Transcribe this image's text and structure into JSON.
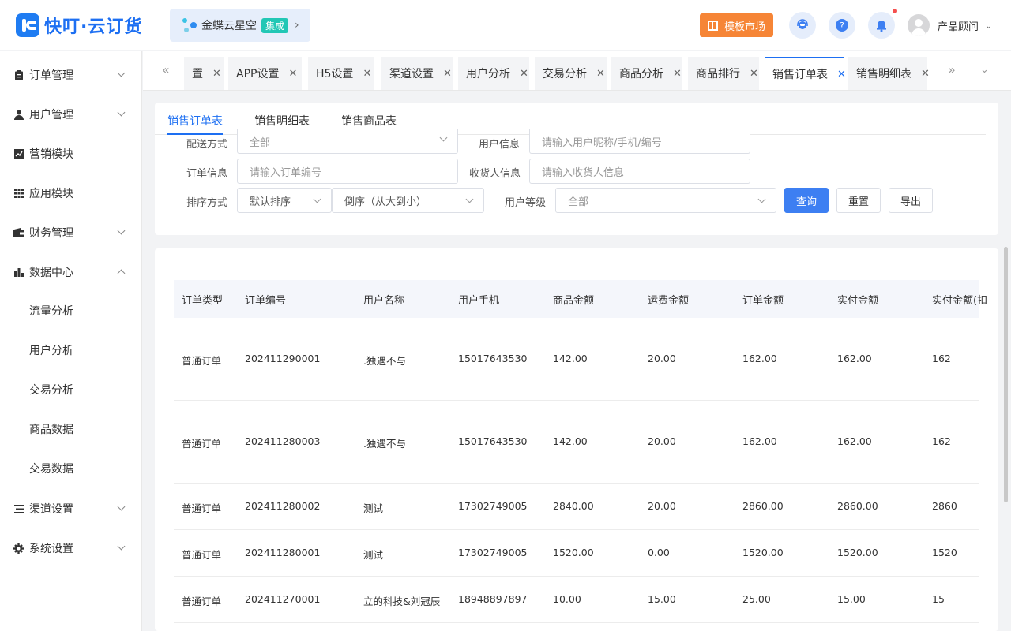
{
  "app": {
    "brand": "快叮·云订货"
  },
  "header": {
    "kingdee_label": "金蝶云星空",
    "kingdee_tag": "集成",
    "template_market": "模板市场",
    "user_name": "产品顾问"
  },
  "sidebar": {
    "items": [
      {
        "label": "订单管理",
        "icon": "clipboard-icon",
        "expandable": true
      },
      {
        "label": "用户管理",
        "icon": "user-icon",
        "expandable": true
      },
      {
        "label": "营销模块",
        "icon": "chart-line-icon",
        "expandable": false
      },
      {
        "label": "应用模块",
        "icon": "grid-icon",
        "expandable": false
      },
      {
        "label": "财务管理",
        "icon": "wallet-icon",
        "expandable": true
      },
      {
        "label": "数据中心",
        "icon": "bar-chart-icon",
        "expandable": true,
        "expanded": true
      },
      {
        "label": "渠道设置",
        "icon": "list-icon",
        "expandable": true
      },
      {
        "label": "系统设置",
        "icon": "gear-icon",
        "expandable": true
      }
    ],
    "data_center_children": [
      "流量分析",
      "用户分析",
      "交易分析",
      "商品数据",
      "交易数据"
    ]
  },
  "tabs": [
    {
      "label": "置"
    },
    {
      "label": "APP设置"
    },
    {
      "label": "H5设置"
    },
    {
      "label": "渠道设置"
    },
    {
      "label": "用户分析"
    },
    {
      "label": "交易分析"
    },
    {
      "label": "商品分析"
    },
    {
      "label": "商品排行"
    },
    {
      "label": "销售订单表",
      "active": true
    },
    {
      "label": "销售明细表"
    }
  ],
  "subtabs": [
    "销售订单表",
    "销售明细表",
    "销售商品表"
  ],
  "filters": {
    "delivery_label": "配送方式",
    "delivery_value": "全部",
    "userinfo_label": "用户信息",
    "userinfo_placeholder": "请输入用户昵称/手机/编号",
    "order_label": "订单信息",
    "order_placeholder": "请输入订单编号",
    "receiver_label": "收货人信息",
    "receiver_placeholder": "请输入收货人信息",
    "sort_label": "排序方式",
    "sort_value": "默认排序",
    "order_dir_value": "倒序（从大到小）",
    "level_label": "用户等级",
    "level_value": "全部",
    "query": "查询",
    "reset": "重置",
    "export": "导出"
  },
  "table": {
    "columns": [
      "订单类型",
      "订单编号",
      "用户名称",
      "用户手机",
      "商品金额",
      "运费金额",
      "订单金额",
      "实付金额",
      "实付金额(扣"
    ],
    "rows": [
      [
        "普通订单",
        "202411290001",
        ".独遇不与",
        "15017643530",
        "142.00",
        "20.00",
        "162.00",
        "162.00",
        "162"
      ],
      [
        "普通订单",
        "202411280003",
        ".独遇不与",
        "15017643530",
        "142.00",
        "20.00",
        "162.00",
        "162.00",
        "162"
      ],
      [
        "普通订单",
        "202411280002",
        "测试",
        "17302749005",
        "2840.00",
        "20.00",
        "2860.00",
        "2860.00",
        "2860"
      ],
      [
        "普通订单",
        "202411280001",
        "测试",
        "17302749005",
        "1520.00",
        "0.00",
        "1520.00",
        "1520.00",
        "1520"
      ],
      [
        "普通订单",
        "202411270001",
        "立的科技&刘冠辰",
        "18948897897",
        "10.00",
        "15.00",
        "25.00",
        "15.00",
        "15"
      ]
    ]
  }
}
